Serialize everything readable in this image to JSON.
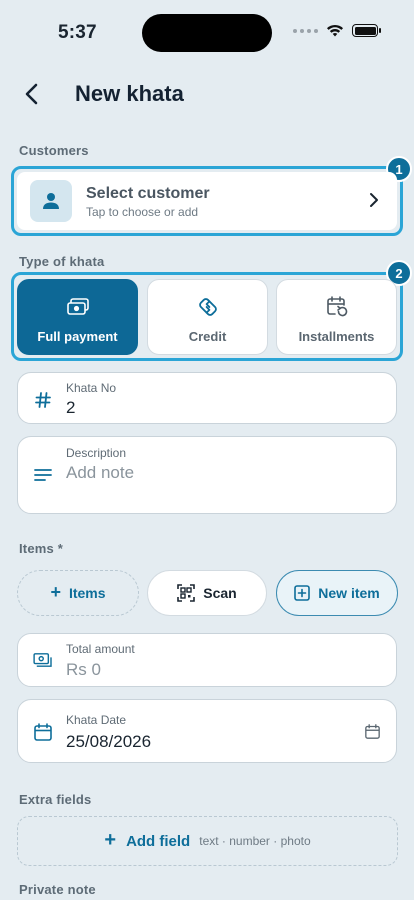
{
  "status": {
    "time": "5:37"
  },
  "header": {
    "title": "New khata"
  },
  "customers": {
    "section_label": "Customers",
    "select_title": "Select customer",
    "select_subtitle": "Tap to choose or add",
    "highlight_number": "1"
  },
  "type_of_khata": {
    "section_label": "Type of khata",
    "highlight_number": "2",
    "options": [
      {
        "label": "Full payment",
        "icon": "cash-icon",
        "selected": true
      },
      {
        "label": "Credit",
        "icon": "handshake-icon",
        "selected": false
      },
      {
        "label": "Installments",
        "icon": "calendar-repeat-icon",
        "selected": false
      }
    ]
  },
  "khata_no": {
    "label": "Khata No",
    "value": "2"
  },
  "description": {
    "label": "Description",
    "placeholder": "Add note"
  },
  "items": {
    "section_label": "Items *",
    "add_items_label": "Items",
    "scan_label": "Scan",
    "new_item_label": "New item"
  },
  "total_amount": {
    "label": "Total amount",
    "value": "Rs 0"
  },
  "khata_date": {
    "label": "Khata Date",
    "value": "25/08/2026"
  },
  "extra_fields": {
    "section_label": "Extra fields",
    "add_field_label": "Add field",
    "add_field_hint": "text · number · photo"
  },
  "private_note": {
    "section_label": "Private note"
  },
  "colors": {
    "accent": "#0d6896",
    "highlight": "#2ba5d6",
    "background": "#e4ecf1"
  }
}
